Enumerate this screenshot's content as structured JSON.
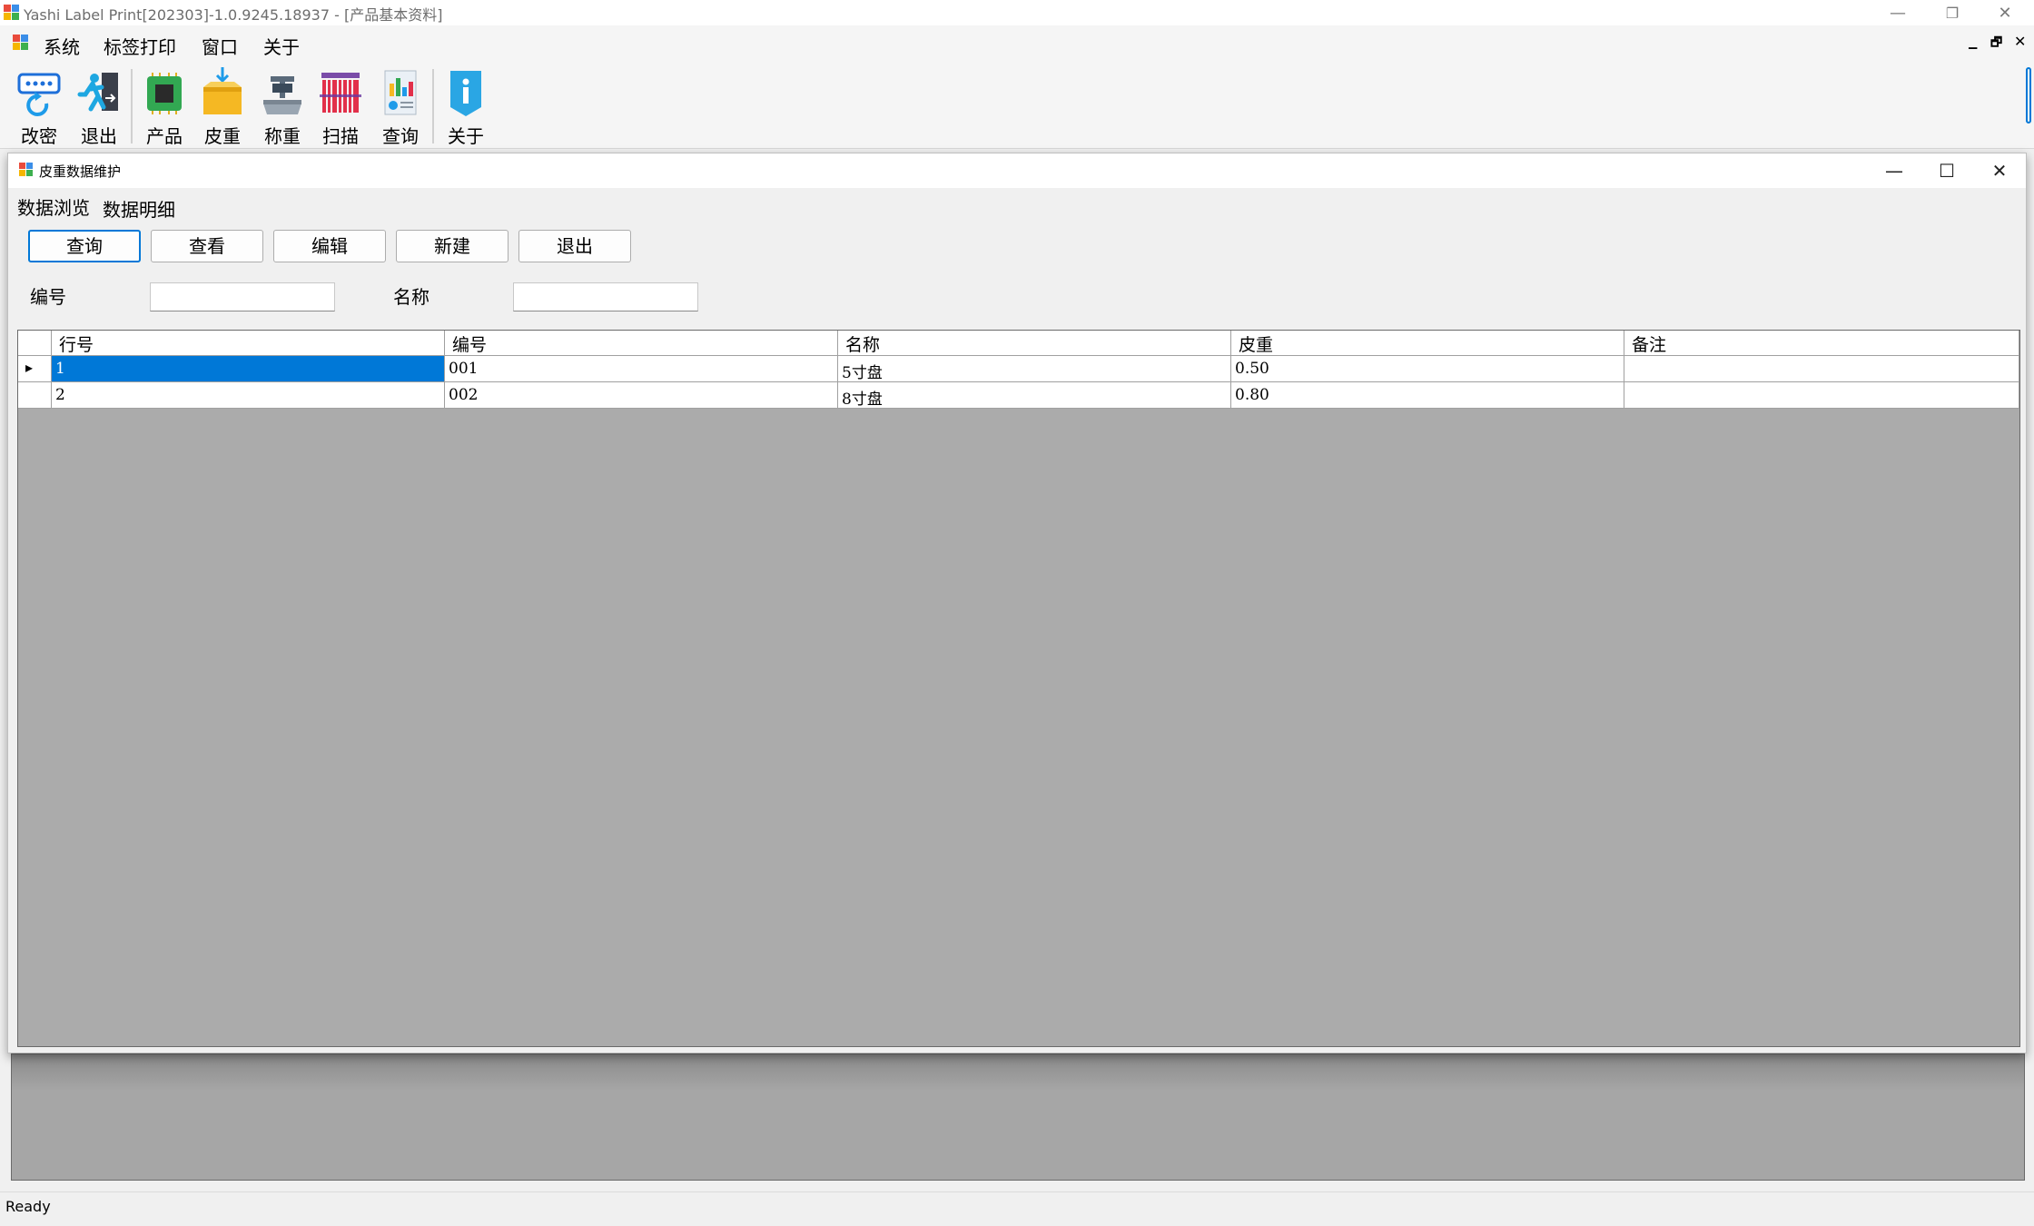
{
  "window": {
    "title": "Yashi Label Print[202303]-1.0.9245.18937 - [产品基本资料]",
    "minimize": "—",
    "restore": "❐",
    "close": "✕"
  },
  "menu": {
    "items": [
      "系统",
      "标签打印",
      "窗口",
      "关于"
    ],
    "mdi_min": "▁",
    "mdi_restore": "🗗",
    "mdi_close": "✕"
  },
  "toolbar": {
    "items": [
      {
        "label": "改密",
        "icon": "password-change-icon"
      },
      {
        "label": "退出",
        "icon": "exit-runner-icon"
      },
      {
        "label": "产品",
        "icon": "product-chip-icon"
      },
      {
        "label": "皮重",
        "icon": "tare-box-icon"
      },
      {
        "label": "称重",
        "icon": "scale-icon"
      },
      {
        "label": "扫描",
        "icon": "barcode-scan-icon"
      },
      {
        "label": "查询",
        "icon": "report-chart-icon"
      },
      {
        "label": "关于",
        "icon": "info-icon"
      }
    ]
  },
  "child": {
    "title": "皮重数据维护",
    "minimize": "—",
    "maximize": "☐",
    "close": "✕",
    "tabs": [
      "数据浏览",
      "数据明细"
    ],
    "buttons": {
      "query": "查询",
      "view": "查看",
      "edit": "编辑",
      "new": "新建",
      "exit": "退出"
    },
    "filters": {
      "code_label": "编号",
      "code_value": "",
      "name_label": "名称",
      "name_value": ""
    },
    "grid": {
      "columns": [
        "行号",
        "编号",
        "名称",
        "皮重",
        "备注"
      ],
      "rows": [
        [
          "1",
          "001",
          "5寸盘",
          "0.50",
          ""
        ],
        [
          "2",
          "002",
          "8寸盘",
          "0.80",
          ""
        ]
      ],
      "selected_row_marker": "▸"
    }
  },
  "status": {
    "text": "Ready"
  },
  "colors": {
    "selection": "#0078d7",
    "focus_border": "#0078d7",
    "grid_bg": "#ababab"
  }
}
